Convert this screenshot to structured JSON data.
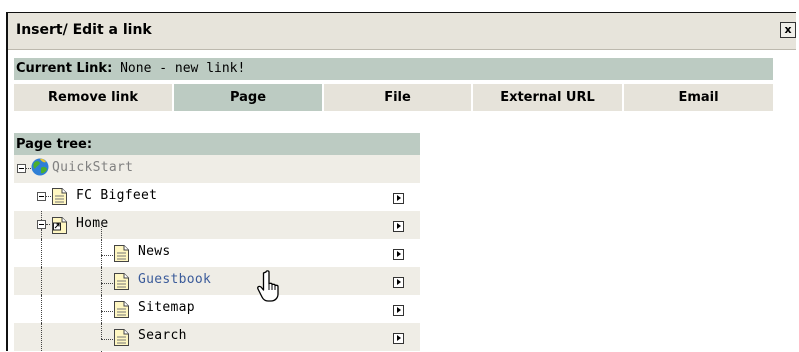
{
  "top_strip_text": "~~~ ~~~ ~~~~~~~~~ ~~~~~~~ ~~~~~~~ ~~~~~~~~",
  "dialog": {
    "title": "Insert/ Edit a link",
    "close_label": "x"
  },
  "current_link": {
    "label": "Current Link:",
    "value": "None - new link!"
  },
  "tabs": [
    {
      "label": "Remove link",
      "active": false
    },
    {
      "label": "Page",
      "active": true
    },
    {
      "label": "File",
      "active": false
    },
    {
      "label": "External URL",
      "active": false
    },
    {
      "label": "Email",
      "active": false
    }
  ],
  "page_tree": {
    "header": "Page tree:",
    "nodes": [
      {
        "label": "QuickStart",
        "icon": "globe-icon",
        "color": "#808080",
        "has_arrow": false
      },
      {
        "label": "FC Bigfeet",
        "icon": "page-icon",
        "color": "#000000",
        "has_arrow": true
      },
      {
        "label": "Home",
        "icon": "page-shortcut-icon",
        "color": "#000000",
        "has_arrow": true
      },
      {
        "label": "News",
        "icon": "page-icon",
        "color": "#000000",
        "has_arrow": true
      },
      {
        "label": "Guestbook",
        "icon": "page-icon",
        "color": "#3b5b9a",
        "has_arrow": true
      },
      {
        "label": "Sitemap",
        "icon": "page-icon",
        "color": "#000000",
        "has_arrow": true
      },
      {
        "label": "Search",
        "icon": "page-icon",
        "color": "#000000",
        "has_arrow": true
      }
    ]
  },
  "colors": {
    "tab_bg": "#e6e3da",
    "active_tab_bg": "#bccbc2",
    "header_bg": "#bccbc2",
    "titlebar_bg": "#e7e4db",
    "hover_link": "#3b5b9a"
  }
}
